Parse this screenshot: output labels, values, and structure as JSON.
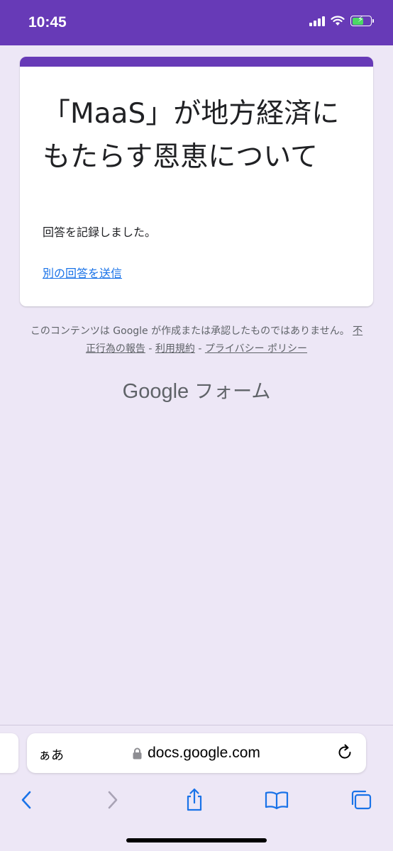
{
  "status": {
    "time": "10:45"
  },
  "form": {
    "title": "「MaaS」が地方経済にもたらす恩恵について",
    "confirmation": "回答を記録しました。",
    "resubmit_link": "別の回答を送信"
  },
  "footer": {
    "disclaimer_text": "このコンテンツは Google が作成または承認したものではありません。",
    "report_link": "不正行為の報告",
    "separator": "-",
    "terms_link": "利用規約",
    "privacy_link": "プライバシー ポリシー",
    "brand_google": "Google",
    "brand_forms": "フォーム"
  },
  "browser": {
    "aa_label": "ぁあ",
    "url": "docs.google.com"
  },
  "colors": {
    "accent": "#673ab7",
    "background": "#ede7f6",
    "link": "#1a73e8"
  },
  "icons": [
    "signal-icon",
    "wifi-icon",
    "battery-icon",
    "lock-icon",
    "reload-icon",
    "back-icon",
    "forward-icon",
    "share-icon",
    "bookmarks-icon",
    "tabs-icon"
  ]
}
